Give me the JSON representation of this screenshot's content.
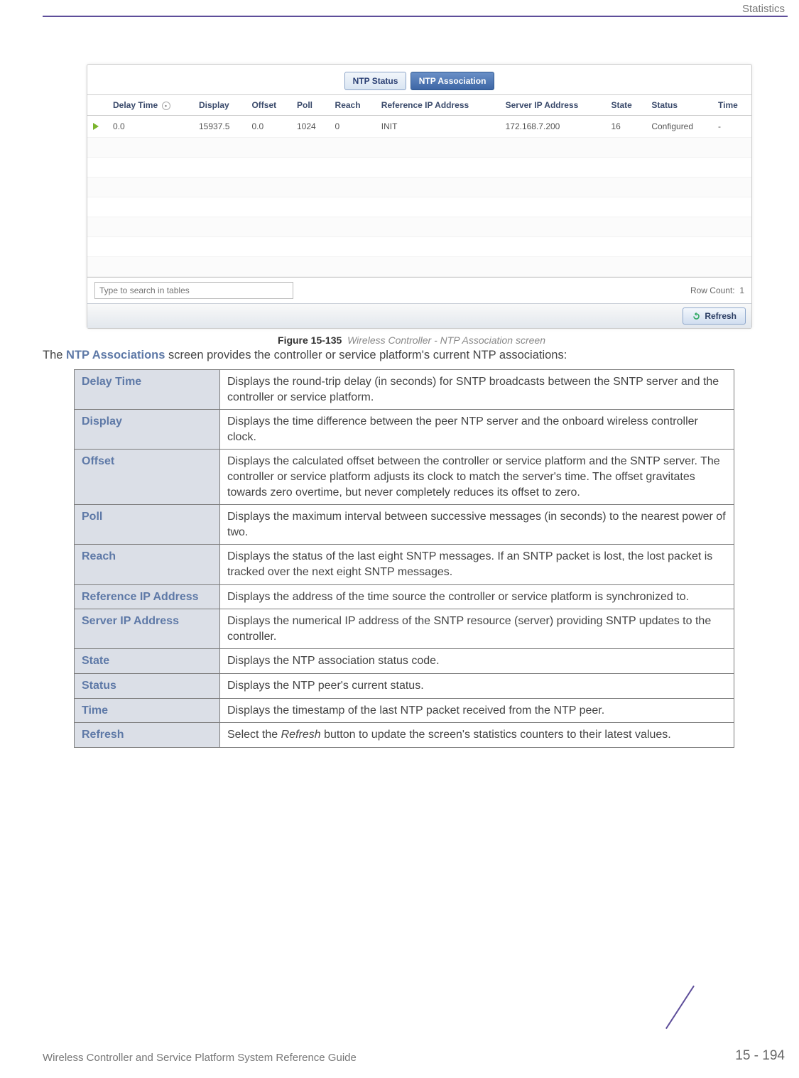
{
  "header": {
    "section": "Statistics"
  },
  "screenshot": {
    "tabs": {
      "inactive": "NTP Status",
      "active": "NTP Association"
    },
    "columns": [
      "",
      "Delay Time",
      "Display",
      "Offset",
      "Poll",
      "Reach",
      "Reference IP Address",
      "Server IP Address",
      "State",
      "Status",
      "Time"
    ],
    "row": {
      "delay": "0.0",
      "display": "15937.5",
      "offset": "0.0",
      "poll": "1024",
      "reach": "0",
      "refip": "INIT",
      "serverip": "172.168.7.200",
      "state": "16",
      "status": "Configured",
      "time": "-"
    },
    "search_placeholder": "Type to search in tables",
    "rowcount_label": "Row Count:",
    "rowcount_value": "1",
    "refresh": "Refresh"
  },
  "caption": {
    "fig_label": "Figure 15-135",
    "fig_title": "Wireless Controller - NTP Association screen"
  },
  "lead": {
    "pre": "The ",
    "bold": "NTP Associations",
    "post": " screen provides the controller or service platform's current NTP associations:"
  },
  "defs": [
    {
      "term": "Delay Time",
      "desc": "Displays the round-trip delay (in seconds) for SNTP broadcasts between the SNTP server and the controller or service platform."
    },
    {
      "term": "Display",
      "desc": "Displays the time difference between the peer NTP server and the onboard wireless controller clock."
    },
    {
      "term": "Offset",
      "desc": "Displays the calculated offset between the controller or service platform and the SNTP server. The controller or service platform adjusts its clock to match the server's time. The offset gravitates towards zero overtime, but never completely reduces its offset to zero."
    },
    {
      "term": "Poll",
      "desc": "Displays the maximum interval between successive messages (in seconds) to the nearest power of two."
    },
    {
      "term": "Reach",
      "desc": "Displays the status of the last eight SNTP messages. If an SNTP packet is lost, the lost packet is tracked over the next eight SNTP messages."
    },
    {
      "term": "Reference IP Address",
      "desc": "Displays the address of the time source the controller or service platform is synchronized to."
    },
    {
      "term": "Server IP Address",
      "desc": "Displays the numerical IP address of the SNTP resource (server) providing SNTP updates to the controller."
    },
    {
      "term": "State",
      "desc": "Displays the NTP association status code."
    },
    {
      "term": "Status",
      "desc": "Displays the NTP peer's current status."
    },
    {
      "term": "Time",
      "desc": "Displays the timestamp of the last NTP packet received from the NTP peer."
    },
    {
      "term": "Refresh",
      "desc_html": "Select the <i>Refresh</i> button to update the screen's statistics counters to their latest values."
    }
  ],
  "footer": {
    "left": "Wireless Controller and Service Platform System Reference Guide",
    "page": "15 - 194"
  }
}
